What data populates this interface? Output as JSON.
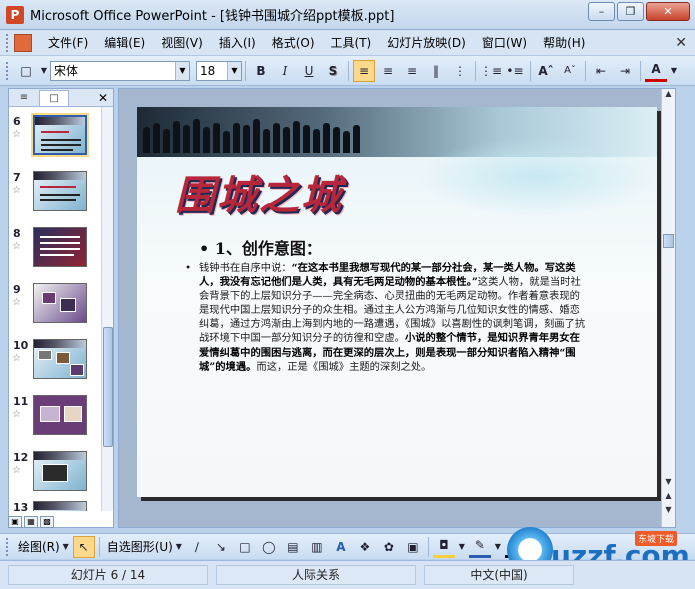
{
  "window": {
    "title": "Microsoft Office PowerPoint - [钱钟书围城介绍ppt模板.ppt]",
    "controls": [
      "minimize",
      "restore",
      "close"
    ]
  },
  "menu": {
    "items": [
      "文件(F)",
      "编辑(E)",
      "视图(V)",
      "插入(I)",
      "格式(O)",
      "工具(T)",
      "幻灯片放映(D)",
      "窗口(W)",
      "帮助(H)"
    ]
  },
  "format_toolbar": {
    "font_name": "宋体",
    "font_size": "18",
    "buttons": [
      "B",
      "I",
      "U",
      "S"
    ]
  },
  "slides_pane": {
    "tabs": [
      "outline",
      "slides"
    ],
    "thumbnails": [
      {
        "number": "6",
        "selected": true
      },
      {
        "number": "7",
        "selected": false
      },
      {
        "number": "8",
        "selected": false
      },
      {
        "number": "9",
        "selected": false
      },
      {
        "number": "10",
        "selected": false
      },
      {
        "number": "11",
        "selected": false
      },
      {
        "number": "12",
        "selected": false
      },
      {
        "number": "13",
        "selected": false
      }
    ]
  },
  "slide": {
    "title": "围城之城",
    "heading": "• 1、创作意图：",
    "body_parts": [
      {
        "bold": false,
        "text": "钱钟书在自序中说："
      },
      {
        "bold": true,
        "text": "“在这本书里我想写现代的某一部分社会，某一类人物。写这类人，我没有忘记他们是人类，具有无毛两足动物的基本根性。”"
      },
      {
        "bold": false,
        "text": "这类人物，就是当时社会背景下的上层知识分子——完全病态、心灵扭曲的无毛两足动物。作者着意表现的是现代中国上层知识分子的众生相。通过主人公方鸿渐与几位知识女性的情感、婚恋纠葛，通过方鸿渐由上海到内地的一路遭遇，《围城》以喜剧性的讽刺笔调，刻画了抗战环境下中国一部分知识分子的彷徨和空虚。"
      },
      {
        "bold": true,
        "text": "小说的整个情节，是知识界青年男女在爱情纠葛中的围困与逃离，而在更深的层次上，则是表现一部分知识者陷入精神“围城”的境遇。"
      },
      {
        "bold": false,
        "text": "而这，正是《围城》主题的深刻之处。"
      }
    ]
  },
  "drawing_toolbar": {
    "draw_label": "绘图(R)",
    "autoshape_label": "自选图形(U)"
  },
  "watermark": {
    "text": "uzzf.com",
    "tag": "东坡下载"
  },
  "status": {
    "slide_position": "幻灯片 6 / 14",
    "design": "人际关系",
    "language": "中文(中国)"
  }
}
